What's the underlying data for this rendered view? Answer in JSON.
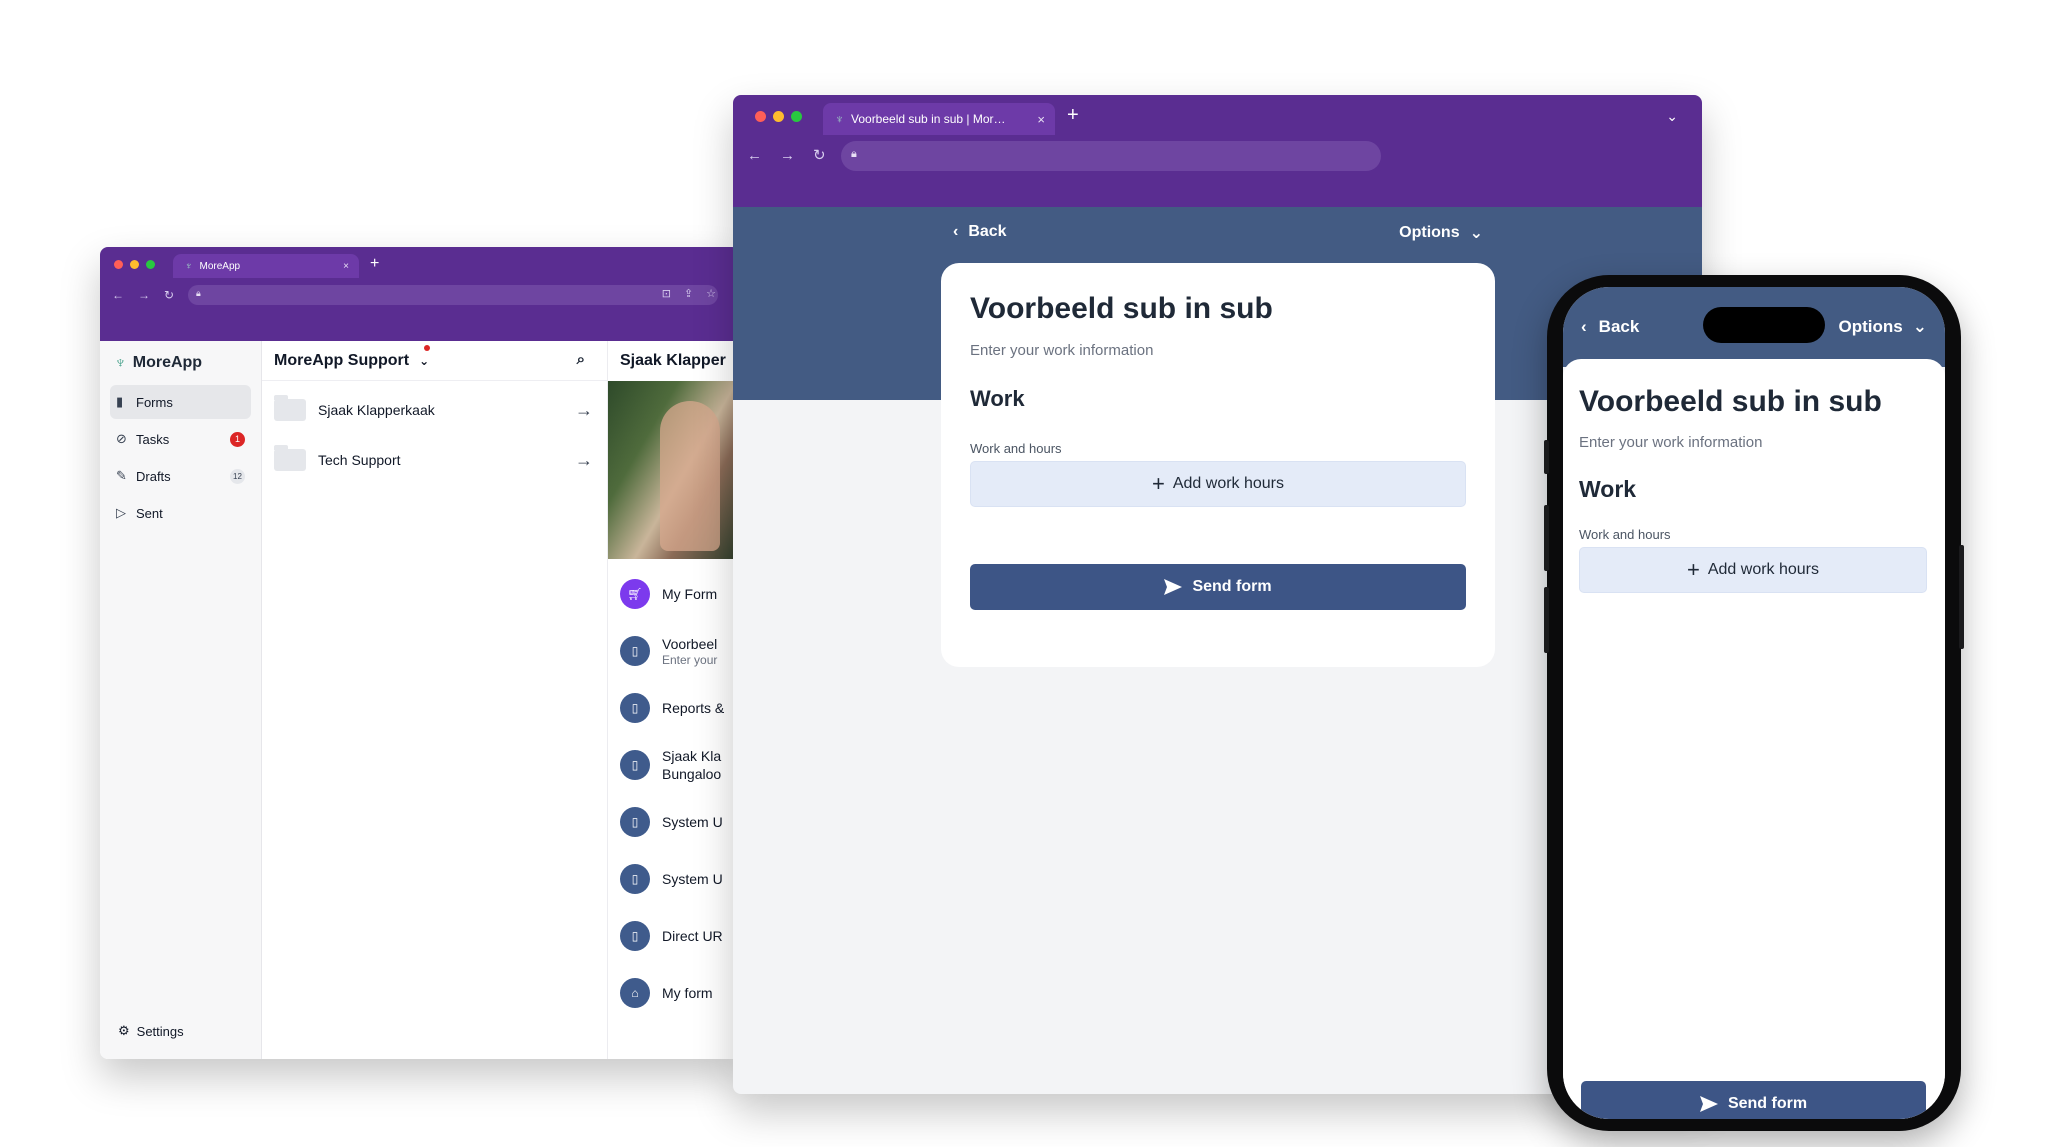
{
  "colors": {
    "chrome": "#5a2d91",
    "primary": "#3d5586",
    "banner": "#435b83",
    "badge": "#dc2626",
    "add_button": "#e4ebf8"
  },
  "left_window": {
    "tab_title": "MoreApp",
    "tab_close": "×",
    "newtab": "+",
    "brand": "MoreApp",
    "sidebar": {
      "items": [
        {
          "label": "Forms",
          "icon": "document-icon"
        },
        {
          "label": "Tasks",
          "icon": "check-circle-icon",
          "badge": "1"
        },
        {
          "label": "Drafts",
          "icon": "pencil-square-icon",
          "badge": "12"
        },
        {
          "label": "Sent",
          "icon": "paper-plane-icon"
        }
      ],
      "settings_label": "Settings"
    },
    "folders": {
      "header": "MoreApp Support",
      "items": [
        {
          "label": "Sjaak Klapperkaak"
        },
        {
          "label": "Tech Support"
        }
      ]
    },
    "forms": {
      "header": "Sjaak Klapper",
      "items": [
        {
          "title": "My Form"
        },
        {
          "title": "Voorbeel",
          "subtitle": "Enter your"
        },
        {
          "title": "Reports &"
        },
        {
          "title": "Sjaak Kla",
          "subtitle": "Bungaloo"
        },
        {
          "title": "System U"
        },
        {
          "title": "System U"
        },
        {
          "title": "Direct UR"
        },
        {
          "title": "My form"
        }
      ]
    }
  },
  "middle_window": {
    "tab_title": "Voorbeeld sub in sub | MoreApp",
    "tab_close": "×",
    "newtab": "+",
    "back_label": "Back",
    "options_label": "Options",
    "form": {
      "title": "Voorbeeld sub in sub",
      "subtitle": "Enter your work information",
      "section": "Work",
      "field_label": "Work and hours",
      "add_button": "Add work hours",
      "send_button": "Send form"
    }
  },
  "phone": {
    "back_label": "Back",
    "options_label": "Options",
    "form": {
      "title": "Voorbeeld sub in sub",
      "subtitle": "Enter your work information",
      "section": "Work",
      "field_label": "Work and hours",
      "add_button": "Add work hours",
      "send_button": "Send form"
    }
  }
}
